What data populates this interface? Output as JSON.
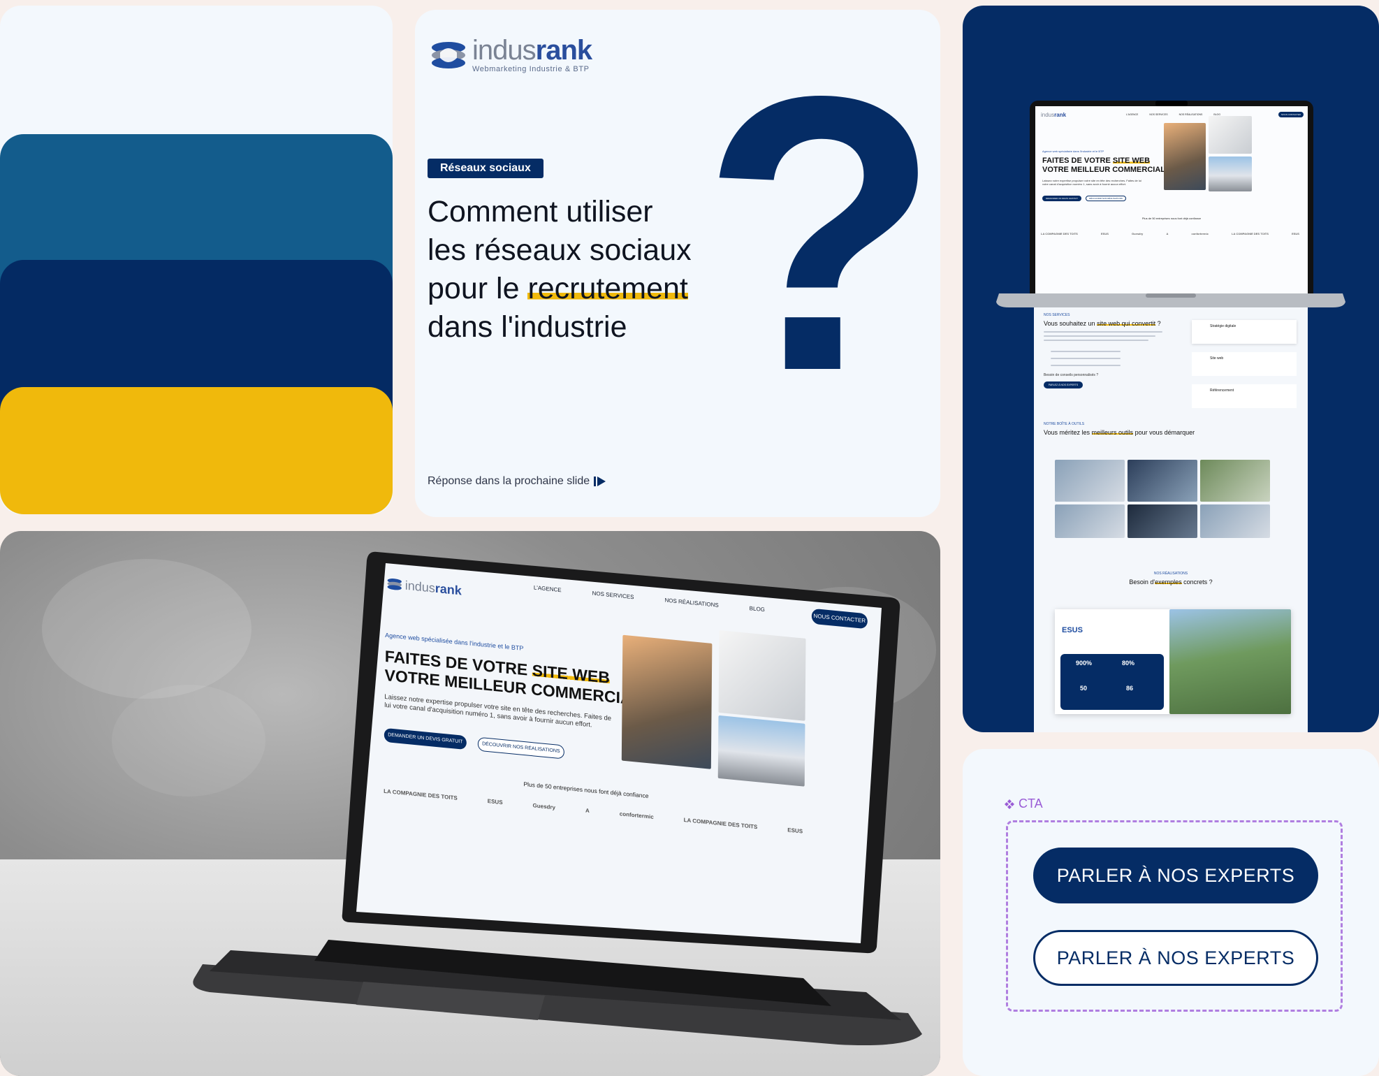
{
  "brand": {
    "name_part1": "indus",
    "name_part2": "rank",
    "tagline": "Webmarketing Industrie & BTP"
  },
  "slide": {
    "tag": "Réseaux sociaux",
    "title_line1": "Comment utiliser",
    "title_line2": "les réseaux sociaux",
    "title_line3_pre": "pour le ",
    "title_line3_highlight": "recrutement",
    "title_line4": "dans l'industrie",
    "question_mark": "?",
    "footer": "Réponse dans la prochaine slide"
  },
  "site": {
    "nav": [
      "L'AGENCE",
      "NOS SERVICES",
      "NOS RÉALISATIONS",
      "BLOG"
    ],
    "contact_button": "NOUS CONTACTER",
    "eyebrow": "Agence web spécialisée dans l'industrie et le BTP",
    "hero_line1_pre": "FAITES DE VOTRE ",
    "hero_line1_highlight": "SITE WEB",
    "hero_line2": "VOTRE MEILLEUR COMMERCIAL",
    "hero_body": "Laissez notre expertise propulser votre site en tête des recherches. Faites de lui votre canal d'acquisition numéro 1, sans avoir à fournir aucun effort.",
    "cta_primary": "DEMANDER UN DEVIS GRATUIT",
    "cta_secondary": "DÉCOUVRIR NOS RÉALISATIONS",
    "trust_line": "Plus de 50 entreprises nous font déjà confiance",
    "client_logos": [
      "LA COMPAGNIE DES TOITS",
      "ESUS",
      "Guesdry",
      "A",
      "confortermic",
      "LA COMPAGNIE DES TOITS",
      "ESUS"
    ],
    "services_eyebrow": "NOS SERVICES",
    "services_title_pre": "Vous souhaitez un ",
    "services_title_highlight": "site web qui convertit",
    "services_title_post": " ?",
    "services_link": "Besoin de conseils personnalisés ?",
    "services_button": "PARLEZ À NOS EXPERTS",
    "service_cards": [
      "Stratégie digitale",
      "Site web",
      "Référencement"
    ],
    "tools_eyebrow": "NOTRE BOÎTE À OUTILS",
    "tools_title_pre": "Vous méritez les ",
    "tools_title_highlight": "meilleurs outils",
    "tools_title_post": " pour vous démarquer",
    "examples_eyebrow": "NOS RÉALISATIONS",
    "examples_title_pre": "Besoin d'",
    "examples_title_highlight": "exemples",
    "examples_title_post": " concrets ?",
    "case_brand": "ESUS",
    "case_stats": [
      {
        "value": "900%"
      },
      {
        "value": "80%"
      },
      {
        "value": "50"
      },
      {
        "value": "86"
      }
    ]
  },
  "cta": {
    "label": "CTA",
    "primary": "PARLER À NOS EXPERTS",
    "secondary": "PARLER À NOS EXPERTS"
  },
  "colors": {
    "navy": "#052c65",
    "blue": "#135c8c",
    "yellow": "#f0b90c",
    "light": "#f3f8fd",
    "purple_dashed": "#b07ee0"
  }
}
